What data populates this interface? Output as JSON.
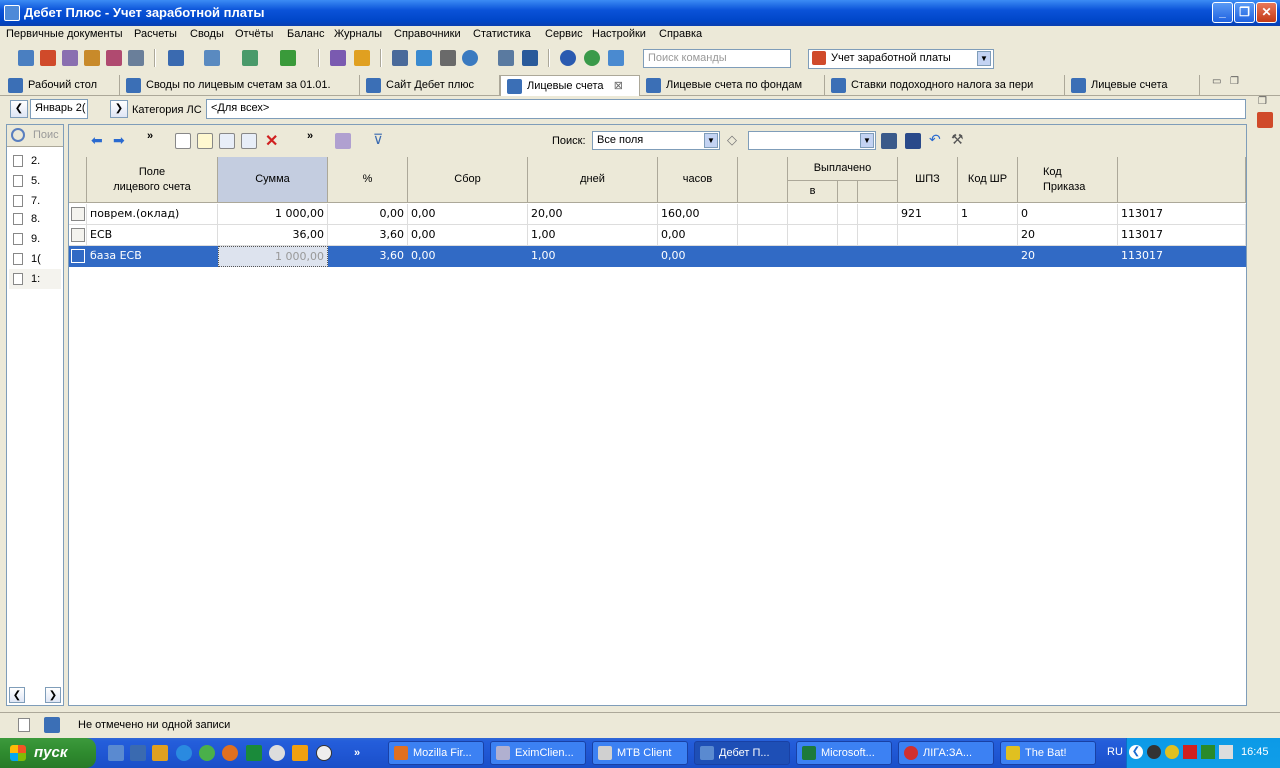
{
  "window": {
    "title": "Дебет Плюс - Учет заработной платы"
  },
  "menu": [
    "Первичные документы",
    "Расчеты",
    "Своды",
    "Отчёты",
    "Баланс",
    "Журналы",
    "Справочники",
    "Статистика",
    "Сервис",
    "Настройки",
    "Справка"
  ],
  "toolbar": {
    "command_search_placeholder": "Поиск команды",
    "module": "Учет заработной платы"
  },
  "tabs": [
    "Рабочий стол",
    "Своды по лицевым счетам  за 01.01.",
    "Сайт Дебет плюс",
    "Лицевые счета",
    "Лицевые счета по фондам",
    "Ставки подоходного налога за пери",
    "Лицевые счета"
  ],
  "nav": {
    "period": "Январь 2(",
    "category_label": "Категория ЛС",
    "category_value": "<Для всех>"
  },
  "left_panel": {
    "search_placeholder": "Поис",
    "items": [
      "2.",
      "5.",
      "7.",
      "8.",
      "9.",
      "1(",
      "1:"
    ]
  },
  "search": {
    "label": "Поиск:",
    "field": "Все поля",
    "value": ""
  },
  "grid": {
    "headers": {
      "field": "Поле\nлицевого счета",
      "sum": "Сумма",
      "pct": "%",
      "fee": "Сбор",
      "days": "дней",
      "hours": "часов",
      "paid": "Выплачено",
      "paid_sub": "в",
      "shpz": "ШПЗ",
      "kod_shr": "Код ШР",
      "kod_prikaza": "Код\nПриказа"
    },
    "rows": [
      {
        "field": " поврем.(оклад)",
        "sum": "1 000,00",
        "pct": "0,00",
        "fee": "0,00",
        "days": "20,00",
        "hours": "160,00",
        "shpz": "921",
        "kod_shr": "1",
        "kod_prikaza": "0",
        "last": "113017"
      },
      {
        "field": "ЕСВ",
        "sum": "36,00",
        "pct": "3,60",
        "fee": "0,00",
        "days": "1,00",
        "hours": "0,00",
        "shpz": "",
        "kod_shr": "",
        "kod_prikaza": "20",
        "last": "113017"
      },
      {
        "field": "база ЕСВ",
        "sum": "1 000,00",
        "pct": "3,60",
        "fee": "0,00",
        "days": "1,00",
        "hours": "0,00",
        "shpz": "",
        "kod_shr": "",
        "kod_prikaza": "20",
        "last": "113017"
      }
    ]
  },
  "status": {
    "text": "Не отмечено ни одной записи"
  },
  "taskbar": {
    "start": "пуск",
    "tasks": [
      "Mozilla Fir...",
      "EximClien...",
      "MTB Client",
      "Дебет П...",
      "Microsoft...",
      "ЛІГА:ЗА...",
      "The Bat!"
    ],
    "lang": "RU",
    "time": "16:45"
  }
}
